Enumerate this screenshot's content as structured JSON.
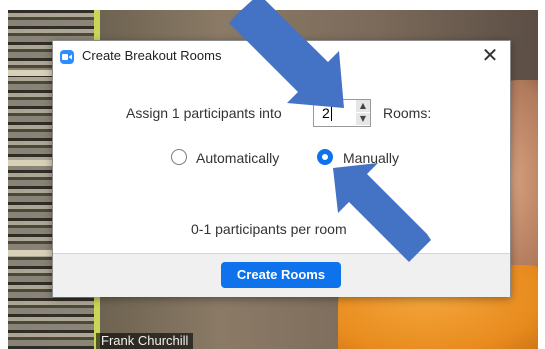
{
  "dialog": {
    "title": "Create Breakout Rooms",
    "close_glyph": "✕",
    "assign_prefix": "Assign 1 participants into",
    "rooms_count": "2",
    "rooms_suffix": "Rooms:",
    "options": [
      {
        "label": "Automatically",
        "selected": false
      },
      {
        "label": "Manually",
        "selected": true
      }
    ],
    "per_room_text": "0-1 participants per room",
    "create_button": "Create Rooms"
  },
  "video": {
    "participant_name": "Frank Churchill"
  },
  "colors": {
    "accent": "#0e72ed",
    "arrow": "#4472c4"
  },
  "icons": {
    "app": "zoom-camera-icon",
    "close": "close-icon",
    "stepper_up": "chevron-up-icon",
    "stepper_down": "chevron-down-icon"
  }
}
